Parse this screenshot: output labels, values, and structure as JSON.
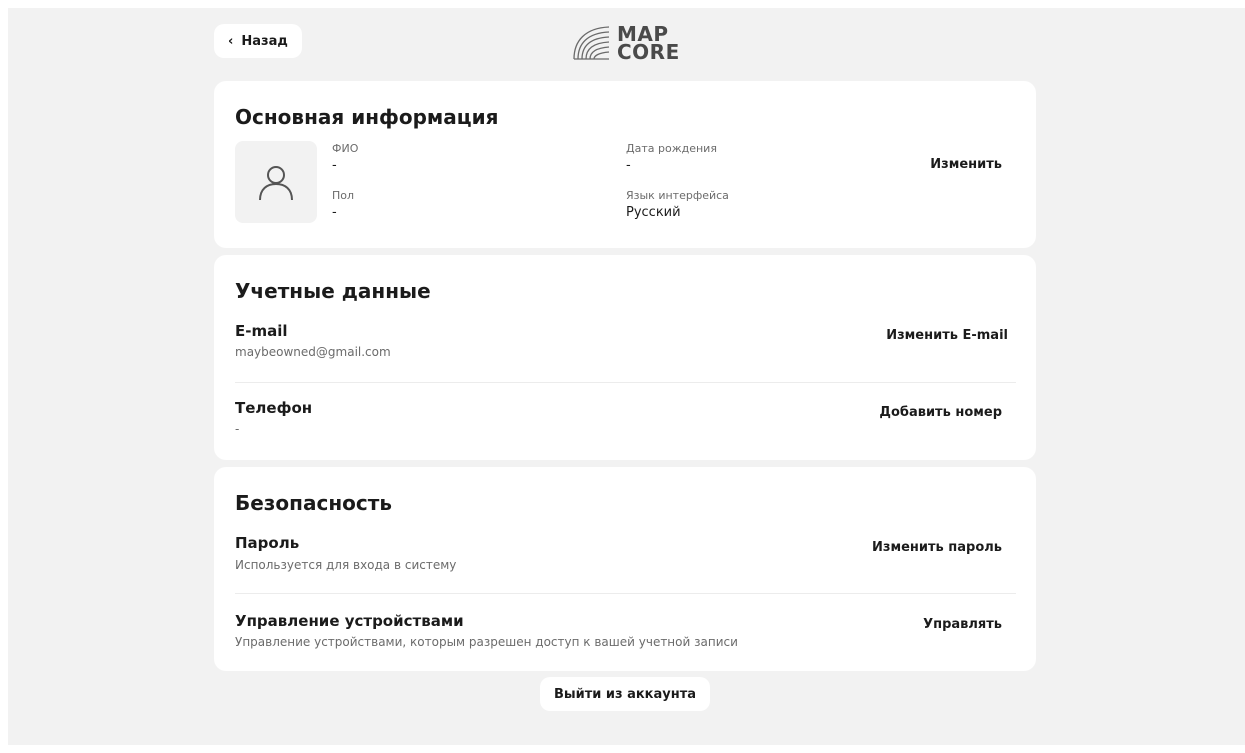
{
  "header": {
    "back_label": "Назад",
    "logo_line1": "MAP",
    "logo_line2": "CORE"
  },
  "basic_info": {
    "title": "Основная информация",
    "fio_label": "ФИО",
    "fio_value": "-",
    "gender_label": "Пол",
    "gender_value": "-",
    "birthdate_label": "Дата рождения",
    "birthdate_value": "-",
    "language_label": "Язык интерфейса",
    "language_value": "Русский",
    "edit_label": "Изменить"
  },
  "credentials": {
    "title": "Учетные данные",
    "email_label": "E-mail",
    "email_value": "maybeowned@gmail.com",
    "email_action": "Изменить E-mail",
    "phone_label": "Телефон",
    "phone_value": "-",
    "phone_action": "Добавить номер"
  },
  "security": {
    "title": "Безопасность",
    "password_label": "Пароль",
    "password_sub": "Используется для входа в систему",
    "password_action": "Изменить пароль",
    "devices_label": "Управление устройствами",
    "devices_sub": "Управление устройствами, которым разрешен доступ к вашей учетной записи",
    "devices_action": "Управлять"
  },
  "footer": {
    "logout_label": "Выйти из аккаунта"
  },
  "colors": {
    "background": "#f2f2f2",
    "card": "#ffffff",
    "text": "#1b1b1b",
    "muted": "#6b6b6b"
  }
}
